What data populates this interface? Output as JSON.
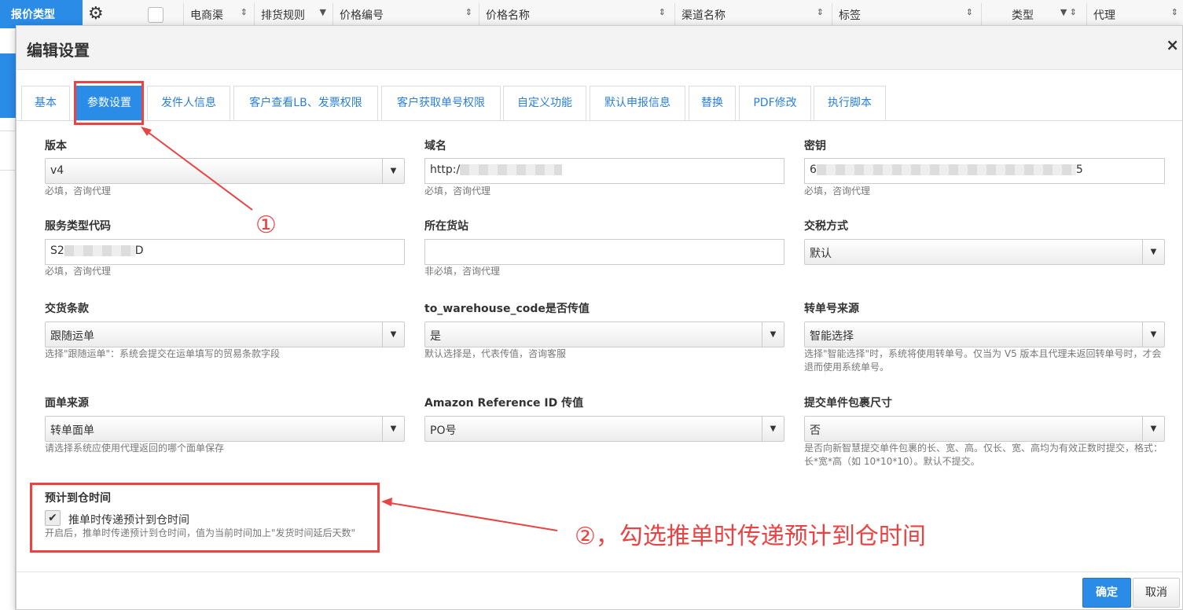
{
  "background_header": {
    "brand": "报价类型",
    "columns": [
      "电商渠",
      "排货规则",
      "价格编号",
      "价格名称",
      "渠道名称",
      "标签",
      "类型",
      "代理"
    ]
  },
  "modal": {
    "title": "编辑设置",
    "close": "×",
    "tabs": [
      "基本",
      "参数设置",
      "发件人信息",
      "客户查看LB、发票权限",
      "客户获取单号权限",
      "自定义功能",
      "默认申报信息",
      "替换",
      "PDF修改",
      "执行脚本"
    ],
    "active_tab": "参数设置"
  },
  "fields": {
    "version": {
      "label": "版本",
      "value": "v4",
      "help": "必填，咨询代理"
    },
    "domain": {
      "label": "域名",
      "value": "http:/",
      "help": "必填，咨询代理"
    },
    "secret": {
      "label": "密钥",
      "value_start": "6",
      "value_end": "5",
      "help": "必填，咨询代理"
    },
    "service_code": {
      "label": "服务类型代码",
      "value_start": "S2",
      "value_end": "D",
      "help": "必填，咨询代理"
    },
    "station": {
      "label": "所在货站",
      "value": "",
      "help": "非必填，咨询代理"
    },
    "tax_method": {
      "label": "交税方式",
      "value": "默认"
    },
    "incoterm": {
      "label": "交货条款",
      "value": "跟随运单",
      "help": "选择\"跟随运单\"：系统会提交在运单填写的贸易条款字段"
    },
    "to_warehouse": {
      "label": "to_warehouse_code是否传值",
      "value": "是",
      "help": "默认选择是，代表传值，咨询客服"
    },
    "tracking_source": {
      "label": "转单号来源",
      "value": "智能选择",
      "help": "选择\"智能选择\"时，系统将使用转单号。仅当为 V5 版本且代理未返回转单号时，才会退而使用系统单号。"
    },
    "label_source": {
      "label": "面单来源",
      "value": "转单面单",
      "help": "请选择系统应使用代理返回的哪个面单保存"
    },
    "amazon_ref": {
      "label": "Amazon Reference ID 传值",
      "value": "PO号"
    },
    "package_size": {
      "label": "提交单件包裹尺寸",
      "value": "否",
      "help": "是否向新智慧提交单件包裹的长、宽、高。仅长、宽、高均为有效正数时提交，格式：长*宽*高（如 10*10*10）。默认不提交。"
    },
    "eta": {
      "label": "预计到仓时间",
      "checkbox_label": "推单时传递预计到仓时间",
      "checked": true,
      "check_glyph": "✔",
      "help": "开启后，推单时传递预计到仓时间，值为当前时间加上\"发货时间延后天数\""
    }
  },
  "annotations": {
    "one": "①",
    "two": "②，勾选推单时传递预计到仓时间"
  },
  "buttons": {
    "ok": "确定",
    "cancel": "取消"
  },
  "colors": {
    "accent": "#2b8ce8",
    "annotation": "#e94343"
  }
}
